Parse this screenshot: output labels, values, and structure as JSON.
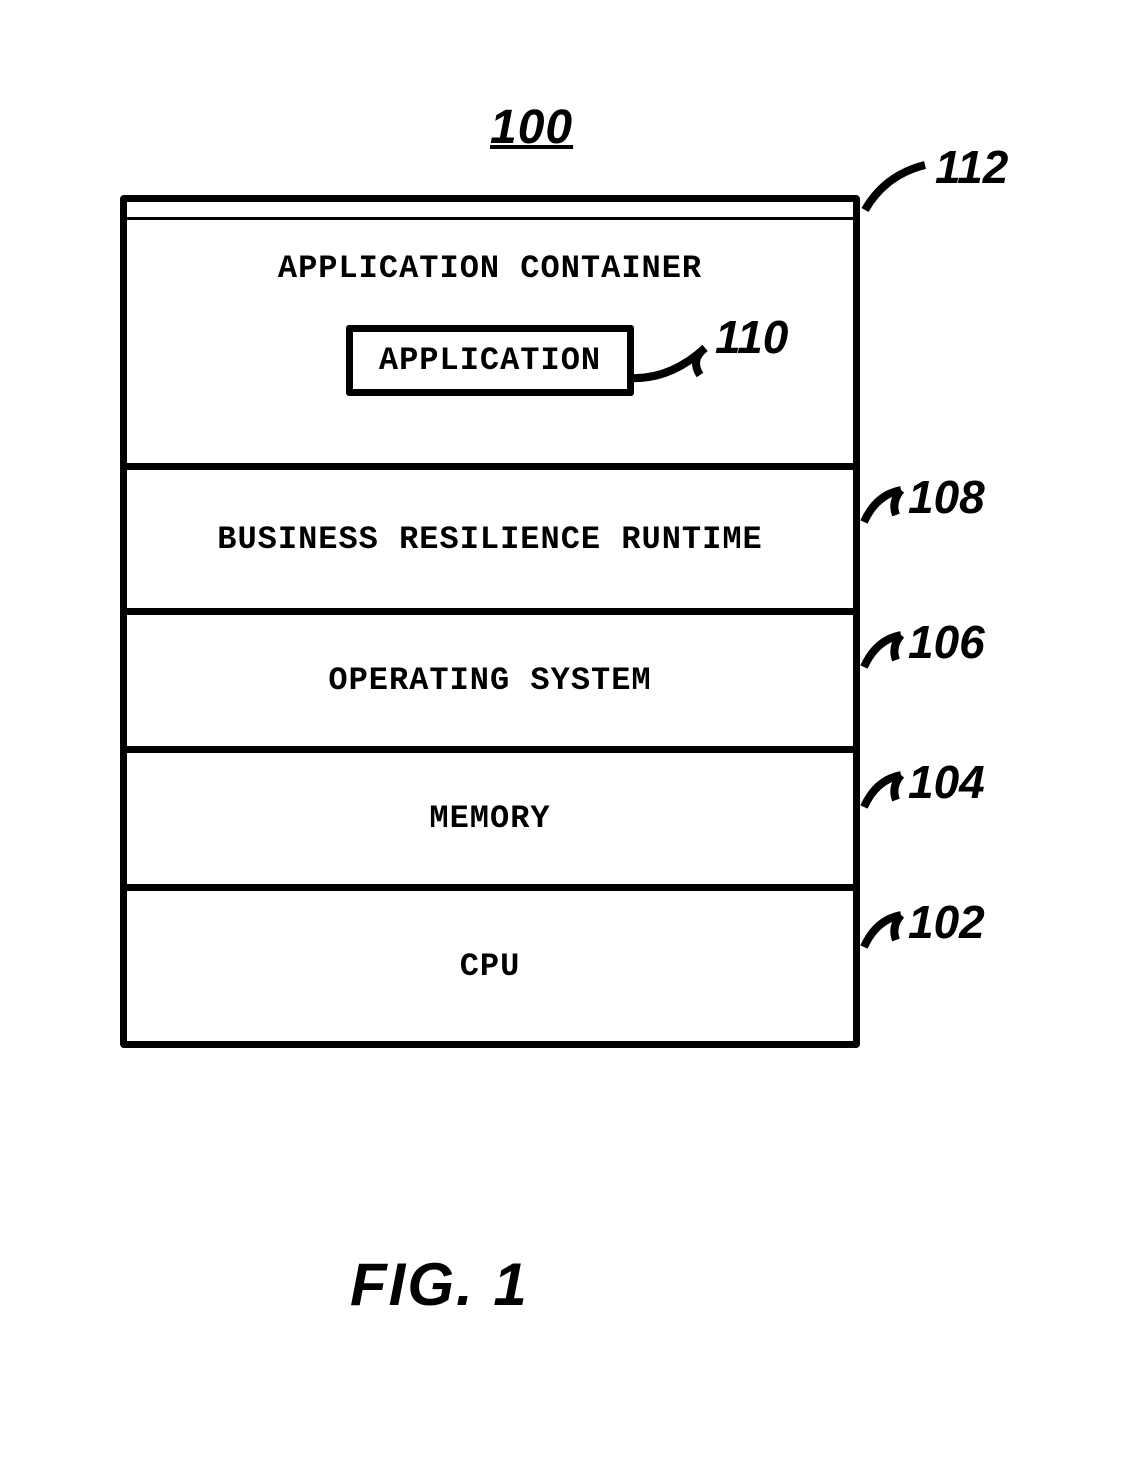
{
  "figure_ref": "100",
  "caption": "FIG. 1",
  "callouts": {
    "c112": "112",
    "c110": "110",
    "c108": "108",
    "c106": "106",
    "c104": "104",
    "c102": "102"
  },
  "layers": {
    "app_container": "APPLICATION CONTAINER",
    "application": "APPLICATION",
    "brr": "BUSINESS RESILIENCE RUNTIME",
    "os": "OPERATING SYSTEM",
    "memory": "MEMORY",
    "cpu": "CPU"
  }
}
